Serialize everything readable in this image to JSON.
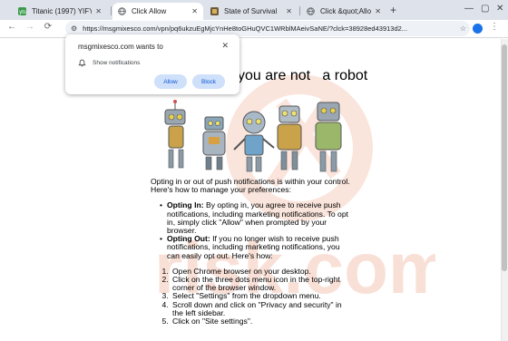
{
  "tabs": [
    {
      "label": "Titanic (1997) YIFY",
      "favicon_color": "#3a9a4a",
      "active": false
    },
    {
      "label": "Click Allow",
      "favicon_color": "#5f6368",
      "active": true
    },
    {
      "label": "State of Survival",
      "favicon_color": "#6b5a3a",
      "active": false
    },
    {
      "label": "Click &quot;Allow",
      "favicon_color": "#5f6368",
      "active": false
    }
  ],
  "toolbar": {
    "url": "https://msgmixesco.com/vpn/pq6ukzuEgMjcYnHe8toGHuQVC1WRblMAeivSaNE/?clck=38928ed43913d2..."
  },
  "popup": {
    "title": "msgmixesco.com wants to",
    "permission": "Show notifications",
    "allow_label": "Allow",
    "block_label": "Block"
  },
  "page": {
    "heading": "you are not   a robot",
    "intro": "Opting in or out of push notifications is within your control. Here's how to manage your preferences:",
    "opting_in_label": "Opting In:",
    "opting_in_text": " By opting in, you agree to receive push notifications, including marketing notifications. To opt in, simply click \"Allow\" when prompted by your browser.",
    "opting_out_label": "Opting Out:",
    "opting_out_text": " If you no longer wish to receive push notifications, including marketing notifications, you can easily opt out. Here's how:",
    "steps": [
      "Open Chrome browser on your desktop.",
      "Click on the three dots menu icon in the top-right corner of the browser window.",
      "Select \"Settings\" from the dropdown menu.",
      "Scroll down and click on \"Privacy and security\" in the left sidebar.",
      "Click on \"Site settings\"."
    ]
  },
  "colors": {
    "accent": "#1a73e8",
    "button_bg": "#cfe0fb",
    "button_text": "#0b57d0",
    "watermark": "#f5c8b8"
  }
}
